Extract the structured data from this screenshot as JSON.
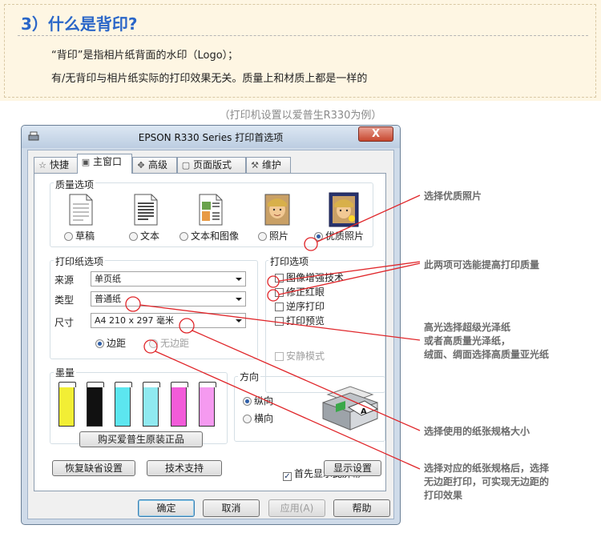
{
  "header": {
    "title": "3）什么是背印?",
    "line1": "“背印”是指相片纸背面的水印（Logo）；",
    "line2": "有/无背印与相片纸实际的打印效果无关。质量上和材质上都是一样的"
  },
  "caption": "（打印机设置以爱普生R330为例）",
  "window": {
    "title": "EPSON R330 Series 打印首选项",
    "close_label": "X",
    "tabs": [
      {
        "label": "快捷",
        "icon": "star-icon"
      },
      {
        "label": "主窗口",
        "icon": "printer-icon"
      },
      {
        "label": "高级",
        "icon": "settings-icon"
      },
      {
        "label": "页面版式",
        "icon": "page-layout-icon"
      },
      {
        "label": "维护",
        "icon": "wrench-icon"
      }
    ],
    "active_tab": "主窗口"
  },
  "quality": {
    "label": "质量选项",
    "options": [
      {
        "label": "草稿",
        "selected": false
      },
      {
        "label": "文本",
        "selected": false
      },
      {
        "label": "文本和图像",
        "selected": false
      },
      {
        "label": "照片",
        "selected": false
      },
      {
        "label": "优质照片",
        "selected": true
      }
    ]
  },
  "paper": {
    "label": "打印纸选项",
    "source_label": "来源",
    "source_value": "单页纸",
    "type_label": "类型",
    "type_value": "普通纸",
    "size_label": "尺寸",
    "size_value": "A4 210 x 297 毫米",
    "margin_label": "边距",
    "borderless_label": "无边距"
  },
  "print_options": {
    "label": "打印选项",
    "items": [
      {
        "label": "图像增强技术",
        "checked": false,
        "disabled": false
      },
      {
        "label": "修正红眼",
        "checked": false,
        "disabled": false
      },
      {
        "label": "逆序打印",
        "checked": false,
        "disabled": false
      },
      {
        "label": "打印预览",
        "checked": false,
        "disabled": false
      }
    ],
    "silent_label": "安静模式"
  },
  "ink": {
    "label": "墨量",
    "colors": [
      "#f2ee35",
      "#111111",
      "#5ce6ef",
      "#8fe9f0",
      "#f25bd9",
      "#f59af0"
    ],
    "buy_label": "购买爱普生原装正品"
  },
  "orientation": {
    "label": "方向",
    "portrait_label": "纵向",
    "landscape_label": "横向",
    "selected": "纵向"
  },
  "show_first_label": "首先显示此屏幕",
  "show_first_checked": true,
  "restore_label": "恢复缺省设置",
  "support_label": "技术支持",
  "show_settings_label": "显示设置",
  "footer": {
    "ok": "确定",
    "cancel": "取消",
    "apply": "应用(A)",
    "help": "帮助"
  },
  "annotations": {
    "a1": "选择优质照片",
    "a2": "此两项可选能提高打印质量",
    "a3": [
      "高光选择超级光泽纸",
      "或者高质量光泽纸，",
      "绒面、绸面选择高质量亚光纸"
    ],
    "a4": "选择使用的纸张规格大小",
    "a5": [
      "选择对应的纸张规格后，选择",
      "无边距打印，可实现无边距的",
      "打印效果"
    ]
  },
  "colors": {
    "accent": "#2a66c8",
    "annotation_red": "#e0262a",
    "annotation_text": "#6b6b6b"
  }
}
